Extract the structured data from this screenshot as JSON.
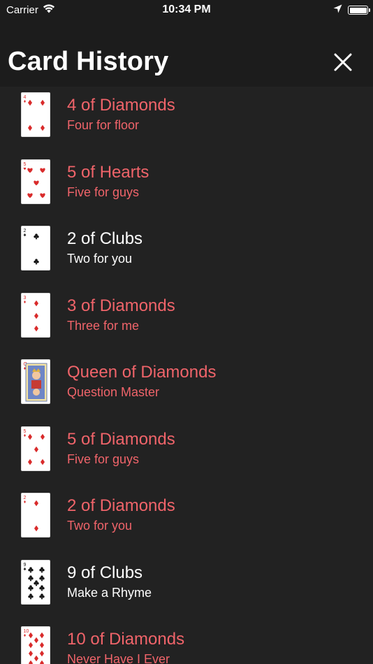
{
  "status_bar": {
    "carrier": "Carrier",
    "time": "10:34 PM"
  },
  "header": {
    "title": "Card History",
    "close_icon": "close-icon"
  },
  "colors": {
    "background": "#222222",
    "header": "#1c1c1c",
    "red_text": "#f0646a",
    "white_text": "#ffffff",
    "diamond_red": "#d92b2b",
    "club_black": "#111111"
  },
  "cards": [
    {
      "name": "4 of Diamonds",
      "rule": "Four for floor",
      "color": "red",
      "rank": "4",
      "suit": "diamond"
    },
    {
      "name": "5 of Hearts",
      "rule": "Five for guys",
      "color": "red",
      "rank": "5",
      "suit": "heart"
    },
    {
      "name": "2 of Clubs",
      "rule": "Two for you",
      "color": "white",
      "rank": "2",
      "suit": "club"
    },
    {
      "name": "3 of Diamonds",
      "rule": "Three for me",
      "color": "red",
      "rank": "3",
      "suit": "diamond"
    },
    {
      "name": "Queen of Diamonds",
      "rule": "Question Master",
      "color": "red",
      "rank": "Q",
      "suit": "diamond"
    },
    {
      "name": "5 of Diamonds",
      "rule": "Five for guys",
      "color": "red",
      "rank": "5",
      "suit": "diamond"
    },
    {
      "name": "2 of Diamonds",
      "rule": "Two for you",
      "color": "red",
      "rank": "2",
      "suit": "diamond"
    },
    {
      "name": "9 of Clubs",
      "rule": "Make a Rhyme",
      "color": "white",
      "rank": "9",
      "suit": "club"
    },
    {
      "name": "10 of Diamonds",
      "rule": "Never Have I Ever",
      "color": "red",
      "rank": "10",
      "suit": "diamond"
    }
  ]
}
